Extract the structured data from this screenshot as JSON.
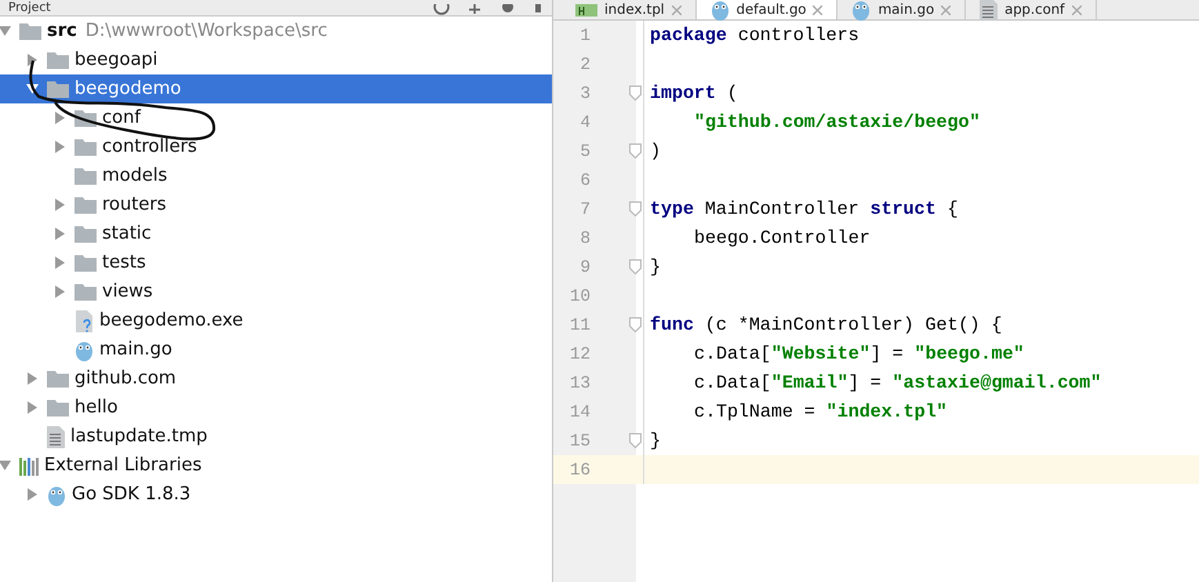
{
  "project_panel": {
    "title": "Project",
    "tree": [
      {
        "label": "src",
        "path": "D:\\wwwroot\\Workspace\\src",
        "kind": "folder",
        "expanded": true,
        "selected": false,
        "children": [
          {
            "label": "beegoapi",
            "kind": "folder",
            "expanded": false,
            "selected": false
          },
          {
            "label": "beegodemo",
            "kind": "folder",
            "expanded": true,
            "selected": true,
            "children": [
              {
                "label": "conf",
                "kind": "folder",
                "expanded": false,
                "selected": false
              },
              {
                "label": "controllers",
                "kind": "folder",
                "expanded": false,
                "selected": false
              },
              {
                "label": "models",
                "kind": "folder",
                "selected": false
              },
              {
                "label": "routers",
                "kind": "folder",
                "expanded": false,
                "selected": false
              },
              {
                "label": "static",
                "kind": "folder",
                "expanded": false,
                "selected": false
              },
              {
                "label": "tests",
                "kind": "folder",
                "expanded": false,
                "selected": false
              },
              {
                "label": "views",
                "kind": "folder",
                "expanded": false,
                "selected": false
              },
              {
                "label": "beegodemo.exe",
                "kind": "unknown",
                "selected": false
              },
              {
                "label": "main.go",
                "kind": "gopher",
                "selected": false
              }
            ]
          },
          {
            "label": "github.com",
            "kind": "folder",
            "expanded": false,
            "selected": false
          },
          {
            "label": "hello",
            "kind": "folder",
            "expanded": false,
            "selected": false
          },
          {
            "label": "lastupdate.tmp",
            "kind": "text",
            "selected": false
          }
        ]
      },
      {
        "label": "External Libraries",
        "kind": "library",
        "expanded": true,
        "selected": false,
        "children": [
          {
            "label": "Go SDK 1.8.3",
            "kind": "gopher",
            "expanded": false,
            "selected": false
          }
        ]
      }
    ]
  },
  "editor": {
    "tabs": [
      {
        "label": "index.tpl",
        "kind": "html",
        "selected": false
      },
      {
        "label": "default.go",
        "kind": "gopher",
        "selected": true
      },
      {
        "label": "main.go",
        "kind": "gopher",
        "selected": false
      },
      {
        "label": "app.conf",
        "kind": "text",
        "selected": false
      }
    ],
    "lines": [
      {
        "number": "1",
        "current": false,
        "tokens": [
          {
            "kind": "keyword",
            "text": "package"
          },
          {
            "kind": "plain",
            "text": " controllers"
          }
        ]
      },
      {
        "number": "2",
        "current": false
      },
      {
        "number": "3",
        "current": false,
        "fold": true,
        "tokens": [
          {
            "kind": "keyword",
            "text": "import"
          },
          {
            "kind": "plain",
            "text": " ("
          }
        ]
      },
      {
        "number": "4",
        "current": false,
        "indented": true,
        "tokens": [
          {
            "kind": "string",
            "text": "\"github.com/astaxie/beego\""
          }
        ]
      },
      {
        "number": "5",
        "current": false,
        "fold": true,
        "tokens": [
          {
            "kind": "plain",
            "text": ")"
          }
        ]
      },
      {
        "number": "6",
        "current": false
      },
      {
        "number": "7",
        "current": false,
        "fold": true,
        "tokens": [
          {
            "kind": "keyword",
            "text": "type"
          },
          {
            "kind": "plain",
            "text": " MainController "
          },
          {
            "kind": "keyword",
            "text": "struct"
          },
          {
            "kind": "plain",
            "text": " {"
          }
        ]
      },
      {
        "number": "8",
        "current": false,
        "indented": true,
        "tokens": [
          {
            "kind": "plain",
            "text": "beego.Controller"
          }
        ]
      },
      {
        "number": "9",
        "current": false,
        "fold": true,
        "tokens": [
          {
            "kind": "plain",
            "text": "}"
          }
        ]
      },
      {
        "number": "10",
        "current": false
      },
      {
        "number": "11",
        "current": false,
        "fold": true,
        "tokens": [
          {
            "kind": "keyword",
            "text": "func"
          },
          {
            "kind": "plain",
            "text": " (c *MainController) Get() {"
          }
        ]
      },
      {
        "number": "12",
        "current": false,
        "indented": true,
        "tokens": [
          {
            "kind": "plain",
            "text": "c.Data["
          },
          {
            "kind": "string",
            "text": "\"Website\""
          },
          {
            "kind": "plain",
            "text": "] = "
          },
          {
            "kind": "string",
            "text": "\"beego.me\""
          }
        ]
      },
      {
        "number": "13",
        "current": false,
        "indented": true,
        "tokens": [
          {
            "kind": "plain",
            "text": "c.Data["
          },
          {
            "kind": "string",
            "text": "\"Email\""
          },
          {
            "kind": "plain",
            "text": "] = "
          },
          {
            "kind": "string",
            "text": "\"astaxie@gmail.com\""
          }
        ]
      },
      {
        "number": "14",
        "current": false,
        "indented": true,
        "tokens": [
          {
            "kind": "plain",
            "text": "c.TplName = "
          },
          {
            "kind": "string",
            "text": "\"index.tpl\""
          }
        ]
      },
      {
        "number": "15",
        "current": false,
        "fold": true,
        "tokens": [
          {
            "kind": "plain",
            "text": "}"
          }
        ]
      },
      {
        "number": "16",
        "current": true
      }
    ]
  }
}
